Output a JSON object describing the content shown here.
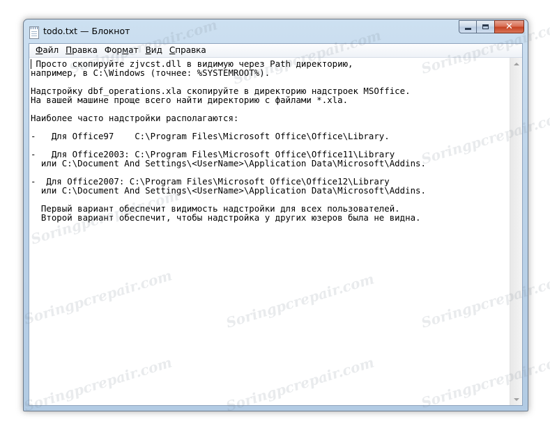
{
  "window": {
    "title": "todo.txt — Блокнот",
    "icon": "notepad-icon",
    "controls": {
      "minimize": "minimize-icon",
      "maximize": "maximize-icon",
      "close_label": "✕"
    }
  },
  "menu": {
    "items": [
      {
        "acc": "Ф",
        "rest": "айл"
      },
      {
        "acc": "П",
        "rest": "равка"
      },
      {
        "pre": "Фор",
        "acc": "м",
        "rest": "ат"
      },
      {
        "acc": "В",
        "rest": "ид"
      },
      {
        "acc": "С",
        "rest": "правка"
      }
    ]
  },
  "editor": {
    "lines": [
      " Просто скопируйте zjvcst.dll в видимую через Path директорию,",
      "например, в C:\\Windows (точнее: %SYSTEMROOT%).",
      "",
      "Надстройку dbf_operations.xla скопируйте в директорию надстроек MSOffice.",
      "На вашей машине проще всего найти директорию с файлами *.xla.",
      "",
      "Наиболее часто надстройки располагаются:",
      "",
      "-   Для Office97    C:\\Program Files\\Microsoft Office\\Office\\Library.",
      "",
      "-   Для Office2003: C:\\Program Files\\Microsoft Office\\Office11\\Library",
      "  или C:\\Document And Settings\\<UserName>\\Application Data\\Microsoft\\Addins.",
      "",
      "-  Для Office2007: C:\\Program Files\\Microsoft Office\\Office12\\Library",
      "  или C:\\Document And Settings\\<UserName>\\Application Data\\Microsoft\\Addins.",
      "",
      "  Первый вариант обеспечит видимость надстройки для всех пользователей.",
      "  Второй вариант обеспечит, чтобы надстройка у других юзеров была не видна."
    ]
  },
  "watermark": "Soringpcrepair.com",
  "colors": {
    "titlebar": "#bcd3e9",
    "close_button": "#c4401f",
    "editor_bg": "#ffffff"
  }
}
